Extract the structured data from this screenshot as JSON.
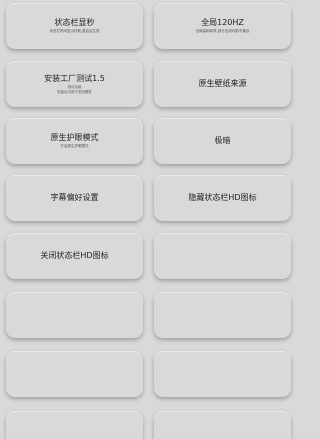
{
  "tiles": [
    {
      "title": "状态栏显秒",
      "sub": "状态栏时间显示秒数,重启后生效"
    },
    {
      "title": "全局120HZ",
      "sub": "全局高刷新率,部分应用可能不兼容"
    },
    {
      "title": "安装工厂测试1.5",
      "sub": "测试功能",
      "sub2": "安装后可用于测试硬件"
    },
    {
      "title": "原生壁纸来源",
      "sub": ""
    },
    {
      "title": "原生护眼模式",
      "sub": "开启原生护眼模式"
    },
    {
      "title": "极暗",
      "sub": ""
    },
    {
      "title": "字幕偏好设置",
      "sub": ""
    },
    {
      "title": "隐藏状态栏HD图标",
      "sub": ""
    },
    {
      "title": "关闭状态栏HD图标",
      "sub": ""
    },
    {
      "title": "",
      "sub": ""
    },
    {
      "title": "",
      "sub": ""
    },
    {
      "title": "",
      "sub": ""
    },
    {
      "title": "",
      "sub": ""
    },
    {
      "title": "",
      "sub": ""
    },
    {
      "title": "",
      "sub": ""
    },
    {
      "title": "",
      "sub": ""
    }
  ]
}
